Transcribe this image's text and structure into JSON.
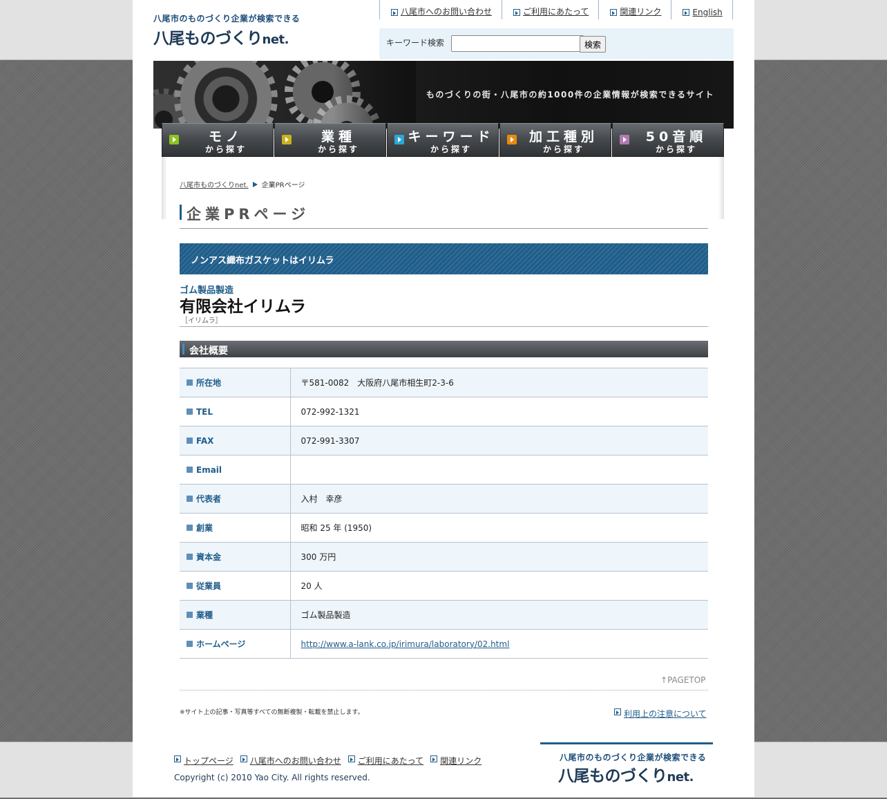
{
  "header": {
    "logo_sub": "八尾市のものづくり企業が検索できる",
    "logo_main": "八尾ものづくり",
    "logo_net": "net.",
    "links": [
      "八尾市へのお問い合わせ",
      "ご利用にあたって",
      "関連リンク",
      "English"
    ],
    "search_label": "キーワード検索",
    "search_value": "",
    "search_button": "検索"
  },
  "banner": {
    "text": "ものづくりの街・八尾市の約1000件の企業情報が検索できるサイト"
  },
  "nav": [
    {
      "big": "モノ",
      "small": "から探す",
      "color": "#8dc21f"
    },
    {
      "big": "業種",
      "small": "から探す",
      "color": "#c8b21a"
    },
    {
      "big": "キーワード",
      "small": "から探す",
      "color": "#2ea7d8"
    },
    {
      "big": "加工種別",
      "small": "から探す",
      "color": "#e88a10"
    },
    {
      "big": "50音順",
      "small": "から探す",
      "color": "#b07ab0"
    }
  ],
  "breadcrumb": {
    "home": "八尾市ものづくりnet.",
    "current": "企業PRページ"
  },
  "page_title": "企業PRページ",
  "pr_banner": "ノンアス織布ガスケットはイリムラ",
  "company": {
    "industry": "ゴム製品製造",
    "name": "有限会社イリムラ",
    "kana": "［イリムラ］"
  },
  "section_title": "会社概要",
  "info_rows": [
    {
      "key": "所在地",
      "value": "〒581-0082　大阪府八尾市相生町2-3-6"
    },
    {
      "key": "TEL",
      "value": "072-992-1321"
    },
    {
      "key": "FAX",
      "value": "072-991-3307"
    },
    {
      "key": "Email",
      "value": ""
    },
    {
      "key": "代表者",
      "value": "入村　幸彦"
    },
    {
      "key": "創業",
      "value": "昭和 25 年 (1950)"
    },
    {
      "key": "資本金",
      "value": "300 万円"
    },
    {
      "key": "従業員",
      "value": "20 人"
    },
    {
      "key": "業種",
      "value": "ゴム製品製造"
    },
    {
      "key": "ホームページ",
      "value": "http://www.a-lank.co.jp/irimura/laboratory/02.html"
    }
  ],
  "pagetop": "PAGETOP",
  "notice": "※サイト上の記事・写真等すべての無断複製・転載を禁止します。",
  "usage_link": "利用上の注意について",
  "footer": {
    "links": [
      "トップページ",
      "八尾市へのお問い合わせ",
      "ご利用にあたって",
      "関連リンク"
    ],
    "copyright": "Copyright (c) 2010 Yao City. All rights reserved.",
    "logo_sub": "八尾市のものづくり企業が検索できる",
    "logo_main": "八尾ものづくり",
    "logo_net": "net."
  }
}
